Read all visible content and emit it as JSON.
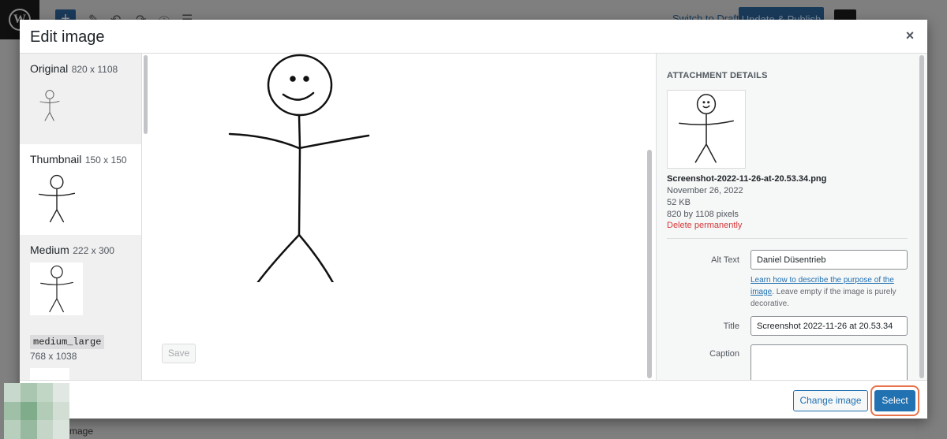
{
  "background": {
    "publish_button": "Update & Publish",
    "switch_to_draft": "Switch to Draft",
    "bottom_text": "mage"
  },
  "modal": {
    "title": "Edit image",
    "close_label": "×"
  },
  "sizes": [
    {
      "name": "Original",
      "dims": "820 x 1108"
    },
    {
      "name": "Thumbnail",
      "dims": "150 x 150"
    },
    {
      "name": "Medium",
      "dims": "222 x 300"
    },
    {
      "name": "medium_large",
      "dims": "768 x 1038"
    }
  ],
  "editor": {
    "save_label": "Save"
  },
  "details": {
    "heading": "ATTACHMENT DETAILS",
    "filename": "Screenshot-2022-11-26-at-20.53.34.png",
    "date": "November 26, 2022",
    "size": "52 KB",
    "dimensions": "820 by 1108 pixels",
    "delete_label": "Delete permanently",
    "alt_text_label": "Alt Text",
    "alt_text_value": "Daniel Düsentrieb",
    "help_link": "Learn how to describe the purpose of the image",
    "help_rest": ". Leave empty if the image is purely decorative.",
    "title_label": "Title",
    "title_value": "Screenshot 2022-11-26 at 20.53.34",
    "caption_label": "Caption"
  },
  "toolbar": {
    "change_label": "Change image",
    "select_label": "Select"
  },
  "colors": {
    "primary": "#2271b1",
    "danger": "#d63638",
    "highlight": "#e8734a"
  }
}
